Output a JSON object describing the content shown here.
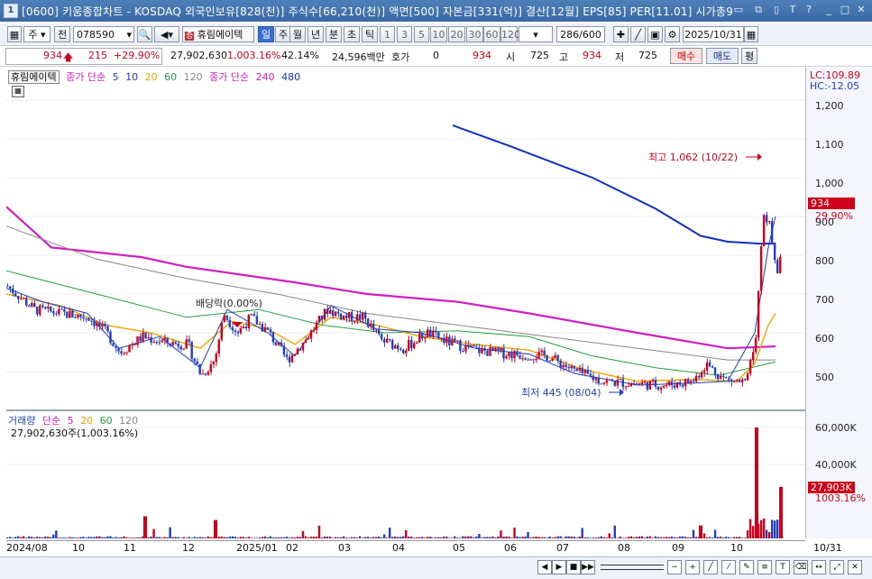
{
  "titlebar": {
    "number": "1",
    "title": "[0600] 키움종합차트 - KOSDAQ 외국인보유[828(천)] 주식수[66,210(천)] 액면[500] 자본금[331(억)] 결산[12월] EPS[85] PER[11.01] 시가총9"
  },
  "toolbar": {
    "type_sel": "주",
    "prev_label": "전",
    "code": "078590",
    "stock_name": "휴림에이텍",
    "period_tabs": [
      "일",
      "주",
      "월",
      "년",
      "분",
      "초",
      "틱"
    ],
    "period_selected": "일",
    "intervals": [
      "1",
      "3",
      "5",
      "10",
      "20",
      "30",
      "60",
      "120"
    ],
    "count": "286",
    "total": "/600",
    "date": "2025/10/31"
  },
  "quote": {
    "price": "934",
    "change": "215",
    "change_pct": "+29.90%",
    "volume": "27,902,630",
    "volume_pct": "1,003.16%",
    "turnover": "42.14%",
    "amount": "24,596백만",
    "hoga_label": "호가",
    "hoga_value": "0",
    "hoga_price": "934",
    "open_label": "시",
    "open": "725",
    "high_label": "고",
    "high": "934",
    "low_label": "저",
    "low": "725",
    "buy_label": "매수",
    "sell_label": "매도",
    "avg_label": "평"
  },
  "price_legend": {
    "name": "휴림에이텍",
    "ma_label1": "종가 단순",
    "ma1": [
      "5",
      "10",
      "20",
      "60",
      "120"
    ],
    "ma_label2": "종가 단순",
    "ma2": [
      "240",
      "480"
    ]
  },
  "price_axis": {
    "lc": "LC:109.89",
    "hc": "HC:-12.05",
    "ticks": [
      "1,200",
      "1,100",
      "1,000",
      "900",
      "800",
      "700",
      "600",
      "500"
    ],
    "current_price": "934",
    "current_pct": "29.90%"
  },
  "annotations": {
    "high": "최고 1,062 (10/22)",
    "low": "최저 445 (08/04)",
    "dividend": "배당락(0.00%)"
  },
  "volume_legend": {
    "label": "거래량",
    "ma_label": "단순",
    "ma": [
      "5",
      "20",
      "60",
      "120"
    ],
    "value": "27,902,630주(1,003.16%)"
  },
  "volume_axis": {
    "ticks": [
      "60,000K",
      "40,000K"
    ],
    "current": "27,903K",
    "current_pct": "1003.16%"
  },
  "x_axis": {
    "labels": [
      "2024/08",
      "10",
      "11",
      "12",
      "2025/01",
      "02",
      "03",
      "04",
      "05",
      "06",
      "07",
      "08",
      "09",
      "10",
      "10/31"
    ]
  },
  "colors": {
    "up": "#d0021b",
    "down": "#1f3fbf",
    "ma5": "#1f3fbf",
    "ma10": "#1f3fbf",
    "ma20": "#f0a500",
    "ma60": "#20a040",
    "ma120": "#888888",
    "ma240": "#d020c0",
    "ma480": "#1030c0"
  }
}
